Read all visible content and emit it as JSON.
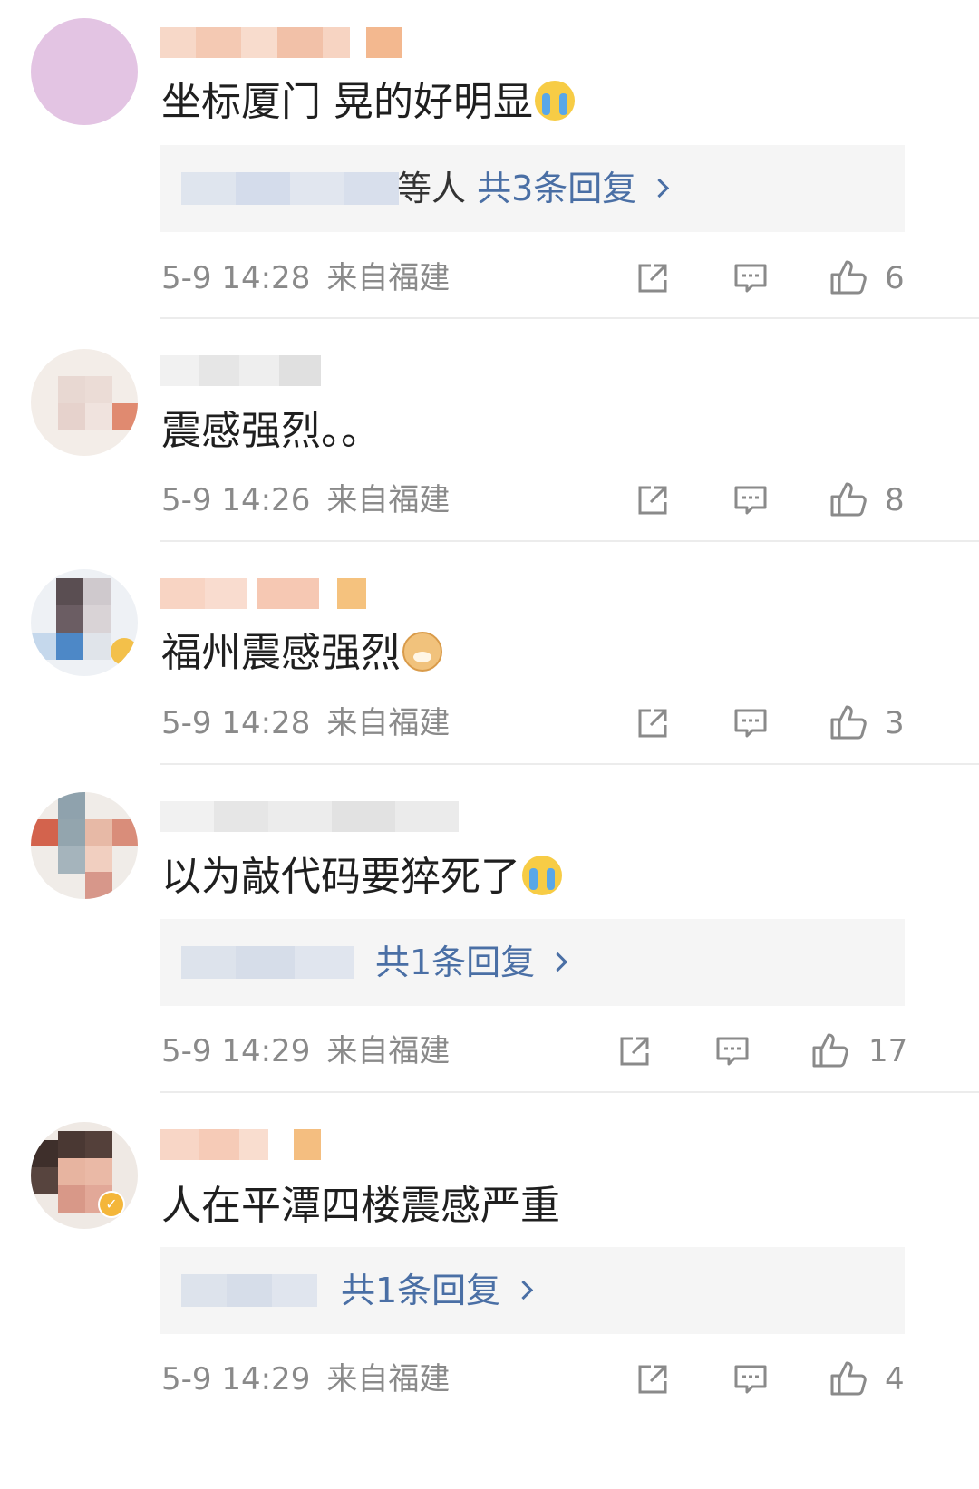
{
  "comments": [
    {
      "text": "坐标厦门 晃的好明显",
      "emoji": "crying-face-icon",
      "reply_preview": {
        "people": "等人",
        "count_label": "共3条回复"
      },
      "time": "5-9 14:28",
      "location": "来自福建",
      "likes": "6"
    },
    {
      "text": "震感强烈。。",
      "emoji": null,
      "reply_preview": null,
      "time": "5-9 14:26",
      "location": "来自福建",
      "likes": "8"
    },
    {
      "text": "福州震感强烈",
      "emoji": "doge-icon",
      "reply_preview": null,
      "time": "5-9 14:28",
      "location": "来自福建",
      "likes": "3"
    },
    {
      "text": "以为敲代码要猝死了",
      "emoji": "crying-face-icon",
      "reply_preview": {
        "people": "",
        "count_label": "共1条回复"
      },
      "time": "5-9 14:29",
      "location": "来自福建",
      "likes": "17"
    },
    {
      "text": "人在平潭四楼震感严重",
      "emoji": null,
      "reply_preview": {
        "people": "",
        "count_label": "共1条回复"
      },
      "time": "5-9 14:29",
      "location": "来自福建",
      "likes": "4"
    }
  ],
  "icons": {
    "share": "share-icon",
    "comment": "comment-icon",
    "like": "thumbs-up-icon"
  },
  "colors": {
    "reply_link": "#4a6fa5",
    "meta_text": "#8a8a8a",
    "reply_bg": "#f5f5f5"
  }
}
